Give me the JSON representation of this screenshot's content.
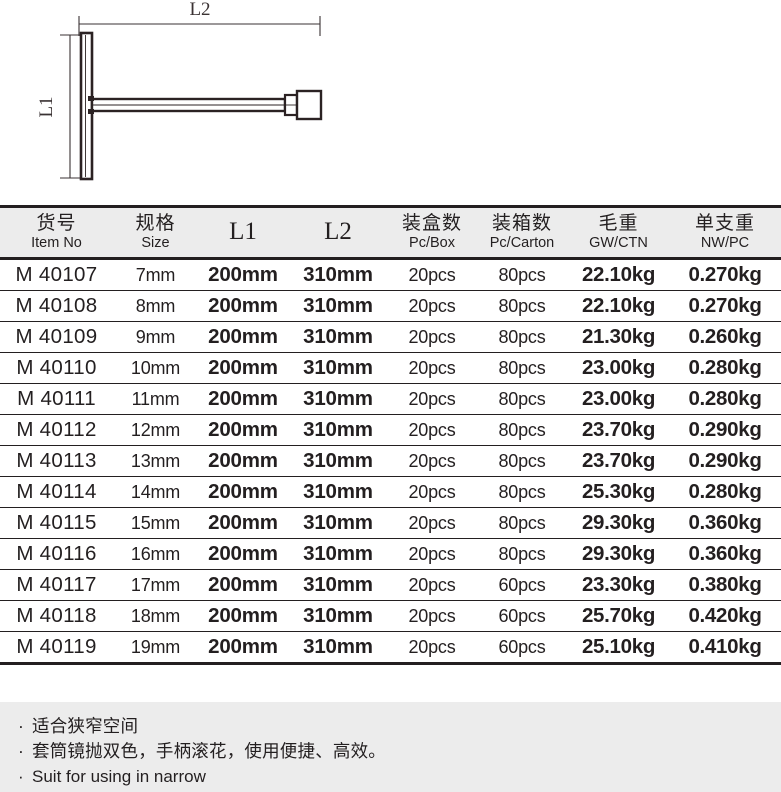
{
  "drawing": {
    "label_l2": "L2",
    "label_l1": "L1",
    "product": "t-handle-socket-wrench"
  },
  "table": {
    "columns": [
      {
        "cn": "货号",
        "en": "Item No",
        "latin": ""
      },
      {
        "cn": "规格",
        "en": "Size",
        "latin": ""
      },
      {
        "cn": "",
        "en": "",
        "latin": "L1"
      },
      {
        "cn": "",
        "en": "",
        "latin": "L2"
      },
      {
        "cn": "装盒数",
        "en": "Pc/Box",
        "latin": ""
      },
      {
        "cn": "装箱数",
        "en": "Pc/Carton",
        "latin": ""
      },
      {
        "cn": "毛重",
        "en": "GW/CTN",
        "latin": ""
      },
      {
        "cn": "单支重",
        "en": "NW/PC",
        "latin": ""
      }
    ],
    "rows": [
      {
        "item": "M 40107",
        "size": "7mm",
        "l1": "200mm",
        "l2": "310mm",
        "box": "20pcs",
        "carton": "80pcs",
        "gw": "22.10kg",
        "nw": "0.270kg"
      },
      {
        "item": "M 40108",
        "size": "8mm",
        "l1": "200mm",
        "l2": "310mm",
        "box": "20pcs",
        "carton": "80pcs",
        "gw": "22.10kg",
        "nw": "0.270kg"
      },
      {
        "item": "M 40109",
        "size": "9mm",
        "l1": "200mm",
        "l2": "310mm",
        "box": "20pcs",
        "carton": "80pcs",
        "gw": "21.30kg",
        "nw": "0.260kg"
      },
      {
        "item": "M 40110",
        "size": "10mm",
        "l1": "200mm",
        "l2": "310mm",
        "box": "20pcs",
        "carton": "80pcs",
        "gw": "23.00kg",
        "nw": "0.280kg"
      },
      {
        "item": "M 40111",
        "size": "11mm",
        "l1": "200mm",
        "l2": "310mm",
        "box": "20pcs",
        "carton": "80pcs",
        "gw": "23.00kg",
        "nw": "0.280kg"
      },
      {
        "item": "M 40112",
        "size": "12mm",
        "l1": "200mm",
        "l2": "310mm",
        "box": "20pcs",
        "carton": "80pcs",
        "gw": "23.70kg",
        "nw": "0.290kg"
      },
      {
        "item": "M 40113",
        "size": "13mm",
        "l1": "200mm",
        "l2": "310mm",
        "box": "20pcs",
        "carton": "80pcs",
        "gw": "23.70kg",
        "nw": "0.290kg"
      },
      {
        "item": "M 40114",
        "size": "14mm",
        "l1": "200mm",
        "l2": "310mm",
        "box": "20pcs",
        "carton": "80pcs",
        "gw": "25.30kg",
        "nw": "0.280kg"
      },
      {
        "item": "M 40115",
        "size": "15mm",
        "l1": "200mm",
        "l2": "310mm",
        "box": "20pcs",
        "carton": "80pcs",
        "gw": "29.30kg",
        "nw": "0.360kg"
      },
      {
        "item": "M 40116",
        "size": "16mm",
        "l1": "200mm",
        "l2": "310mm",
        "box": "20pcs",
        "carton": "80pcs",
        "gw": "29.30kg",
        "nw": "0.360kg"
      },
      {
        "item": "M 40117",
        "size": "17mm",
        "l1": "200mm",
        "l2": "310mm",
        "box": "20pcs",
        "carton": "60pcs",
        "gw": "23.30kg",
        "nw": "0.380kg"
      },
      {
        "item": "M 40118",
        "size": "18mm",
        "l1": "200mm",
        "l2": "310mm",
        "box": "20pcs",
        "carton": "60pcs",
        "gw": "25.70kg",
        "nw": "0.420kg"
      },
      {
        "item": "M 40119",
        "size": "19mm",
        "l1": "200mm",
        "l2": "310mm",
        "box": "20pcs",
        "carton": "60pcs",
        "gw": "25.10kg",
        "nw": "0.410kg"
      }
    ]
  },
  "description": {
    "bullet": "·",
    "lines": [
      "适合狭窄空间",
      "套筒镜抛双色，手柄滚花，使用便捷、高效。",
      "Suit for using in narrow"
    ]
  },
  "colors": {
    "ink": "#231f20",
    "panel_gray": "#ececec",
    "page_white": "#ffffff"
  }
}
